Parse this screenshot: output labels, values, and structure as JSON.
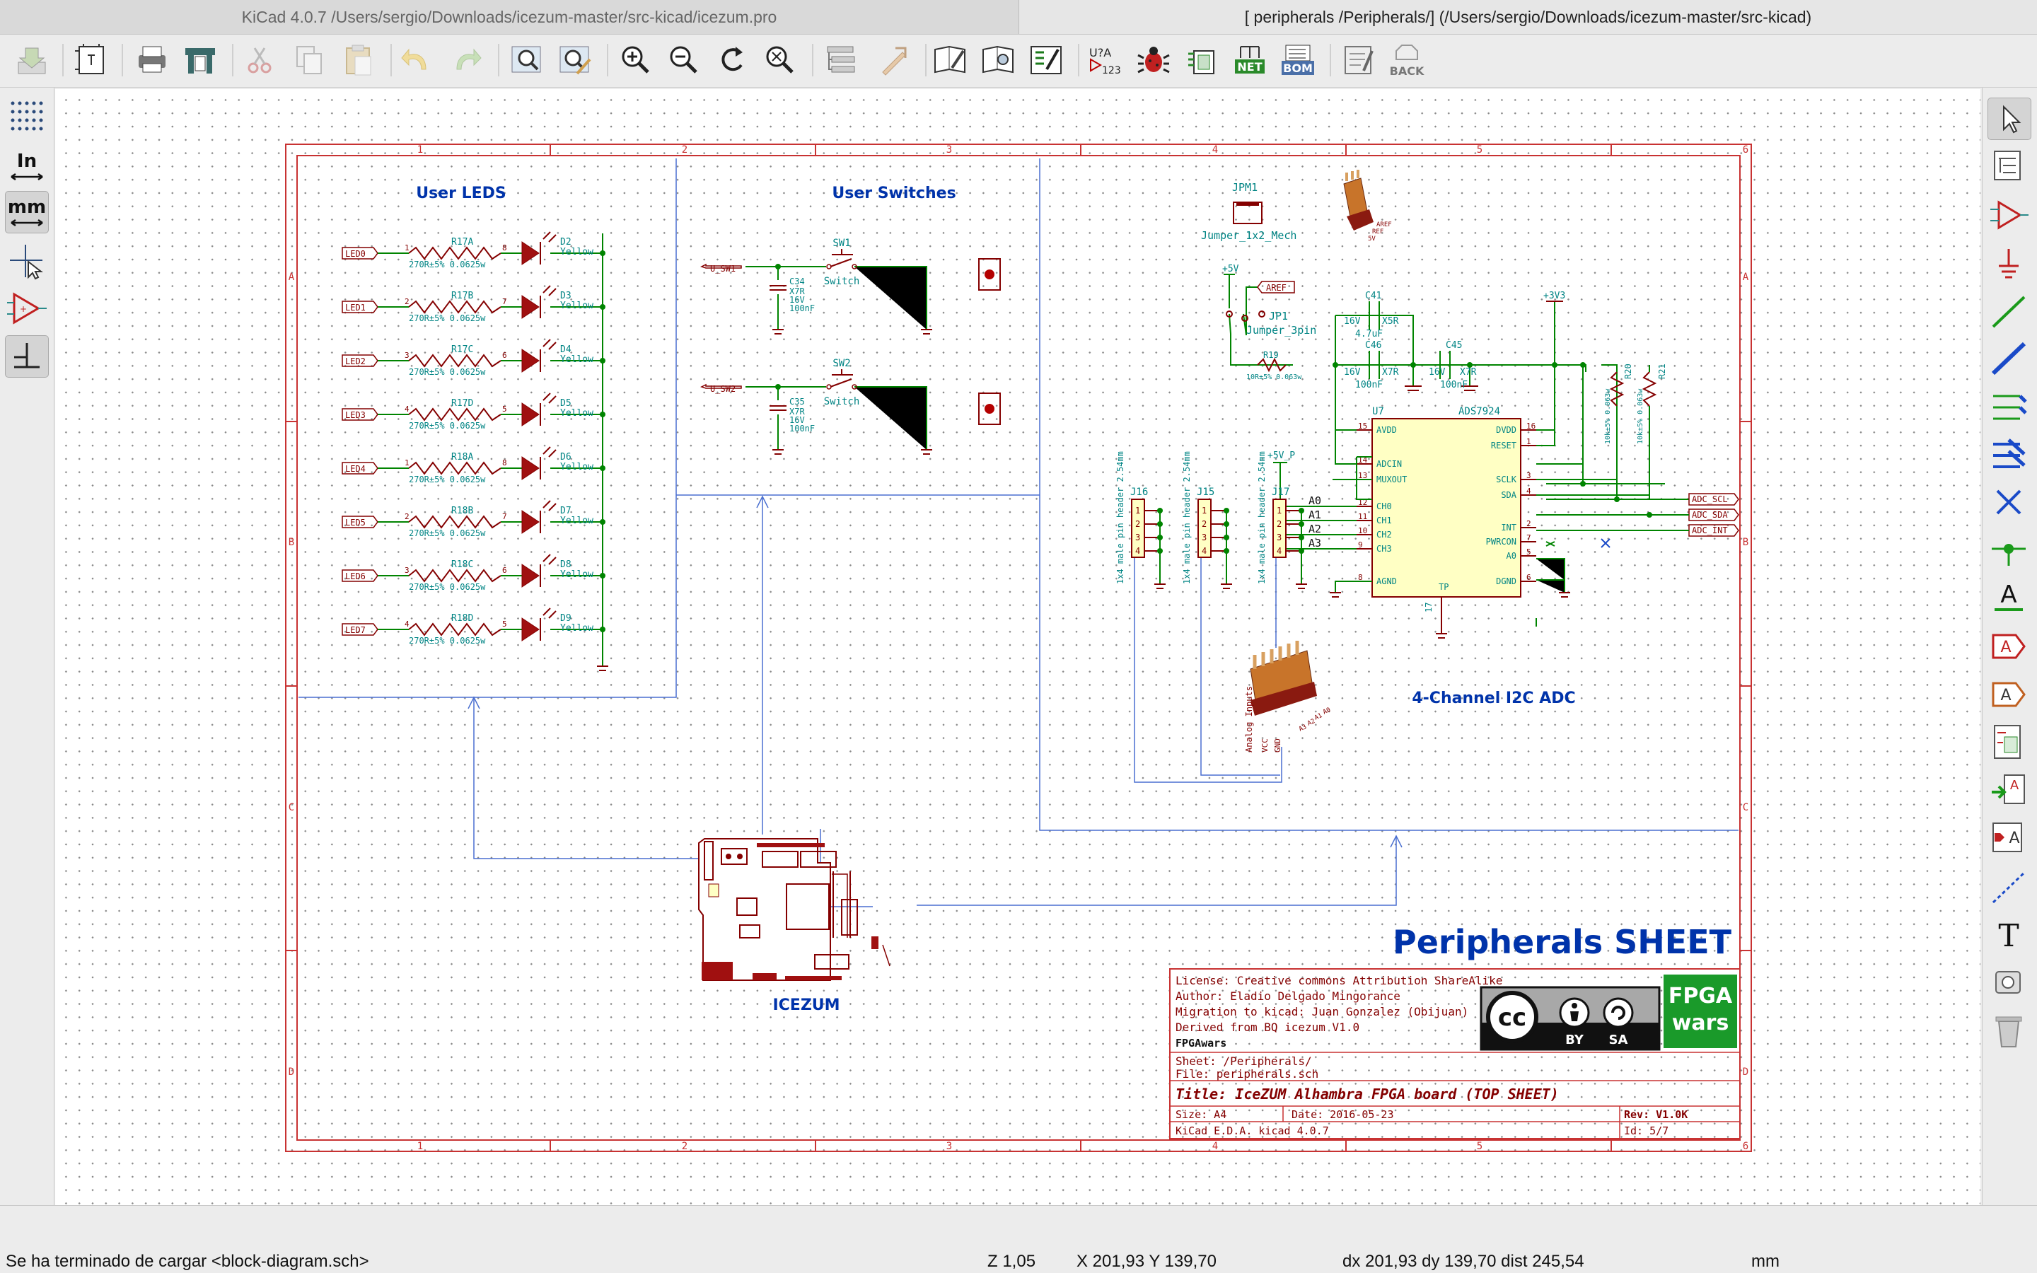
{
  "window": {
    "left_title": "KiCad 4.0.7 /Users/sergio/Downloads/icezum-master/src-kicad/icezum.pro",
    "right_title": "[ peripherals /Peripherals/] (/Users/sergio/Downloads/icezum-master/src-kicad)"
  },
  "toolbar": {
    "items": [
      "save-icon",
      "page-settings-icon",
      "print-icon",
      "plot-icon",
      "cut-icon",
      "copy-icon",
      "paste-icon",
      "undo-icon",
      "redo-icon",
      "find-icon",
      "find-replace-icon",
      "zoom-in-icon",
      "zoom-out-icon",
      "redraw-icon",
      "zoom-fit-icon",
      "hierarchy-navigator-icon",
      "leave-sheet-icon",
      "library-editor-icon",
      "library-browser-icon",
      "annotate-icon",
      "erc-icon",
      "cvpcb-icon",
      "netlist-icon",
      "bom-icon",
      "pcbnew-icon",
      "back-annotate-icon"
    ],
    "annotate_text": "U?A 123",
    "netlist_text": "NET",
    "bom_text": "BOM",
    "back_text": "BACK"
  },
  "left_toolbar": {
    "units_in": "In",
    "units_mm": "mm"
  },
  "right_toolbar": {
    "items": [
      "select-icon",
      "hierarchy-icon",
      "place-component-icon",
      "place-power-icon",
      "wire-icon",
      "bus-icon",
      "wire-bus-entry-icon",
      "bus-bus-entry-icon",
      "no-connect-icon",
      "junction-icon",
      "net-label-icon",
      "global-label-icon",
      "hierarchical-label-icon",
      "hierarchical-sheet-icon",
      "import-sheet-pin-icon",
      "sheet-pin-icon",
      "graphic-line-icon",
      "text-icon",
      "image-icon",
      "delete-icon"
    ],
    "text_letter": "A",
    "text_tool": "T"
  },
  "sheet": {
    "col_marks": [
      "1",
      "2",
      "3",
      "4",
      "5",
      "6"
    ],
    "row_marks": [
      "A",
      "B",
      "C",
      "D"
    ],
    "user_leds_title": "User LEDS",
    "user_switches_title": "User Switches",
    "adc_title": "4-Channel I2C ADC",
    "icezum_label": "ICEZUM",
    "sheet_title": "Peripherals SHEET",
    "leds": [
      {
        "net": "LED0",
        "ref": "R17A",
        "led": "D2",
        "p1": "1",
        "p2": "8"
      },
      {
        "net": "LED1",
        "ref": "R17B",
        "led": "D3",
        "p1": "2",
        "p2": "7"
      },
      {
        "net": "LED2",
        "ref": "R17C",
        "led": "D4",
        "p1": "3",
        "p2": "6"
      },
      {
        "net": "LED3",
        "ref": "R17D",
        "led": "D5",
        "p1": "4",
        "p2": "5"
      },
      {
        "net": "LED4",
        "ref": "R18A",
        "led": "D6",
        "p1": "1",
        "p2": "8"
      },
      {
        "net": "LED5",
        "ref": "R18B",
        "led": "D7",
        "p1": "2",
        "p2": "7"
      },
      {
        "net": "LED6",
        "ref": "R18C",
        "led": "D8",
        "p1": "3",
        "p2": "6"
      },
      {
        "net": "LED7",
        "ref": "R18D",
        "led": "D9",
        "p1": "4",
        "p2": "5"
      }
    ],
    "resistor_value": "270R±5% 0.0625w",
    "led_color": "Yellow",
    "switches": [
      {
        "net": "U_SW1",
        "cap": "C34",
        "sw": "SW1"
      },
      {
        "net": "U_SW2",
        "cap": "C35",
        "sw": "SW2"
      }
    ],
    "switch_label": "Switch",
    "cap_x7r": "X7R",
    "cap_16v": "16V",
    "cap_100nf": "100nF",
    "jpm1_ref": "JPM1",
    "jpm1_val": "Jumper_1x2_Mech",
    "aref_big": "AREF",
    "ref_big": "REF",
    "v5_big": "5V",
    "plus5v": "+5V",
    "aref": "AREF",
    "jp1_ref": "JP1",
    "jp1_val": "Jumper_3pin",
    "r19_ref": "R19",
    "r19_val": "10R±5% 0.063w",
    "c41_ref": "C41",
    "c41_v": "16V",
    "c41_d": "X5R",
    "c41_val": "4.7uF",
    "c46_ref": "C46",
    "c45_ref": "C45",
    "v3v3": "+3V3",
    "r20_ref": "R20",
    "r21_ref": "R21",
    "r20_val": "10k±5% 0.063w",
    "u7_ref": "U7",
    "u7_part": "ADS7924",
    "u7_left": [
      "AVDD",
      "ADCIN",
      "MUXOUT",
      "CH0",
      "CH1",
      "CH2",
      "CH3",
      "AGND"
    ],
    "u7_left_pins": [
      "15",
      "14",
      "13",
      "12",
      "11",
      "10",
      "9",
      "8"
    ],
    "u7_right": [
      "DVDD",
      "RESET",
      "SCLK",
      "SDA",
      "INT",
      "PWRCON",
      "A0",
      "DGND"
    ],
    "u7_right_pins": [
      "16",
      "1",
      "3",
      "4",
      "2",
      "7",
      "5",
      "6"
    ],
    "u7_tp": "TP",
    "u7_tp_pin": "17",
    "adc_scl": "ADC_SCL",
    "adc_sda": "ADC_SDA",
    "adc_int": "ADC_INT",
    "a_labels": [
      "A0",
      "A1",
      "A2",
      "A3"
    ],
    "plus5v_p": "+5V_P",
    "j16": "J16",
    "j15": "J15",
    "j17": "J17",
    "header_label": "1x4 male pin header 2.54mm",
    "pin_nums": [
      "1",
      "2",
      "3",
      "4"
    ],
    "analog_inputs": "Analog Inputs",
    "vcc": "VCC",
    "gnd": "GND",
    "a_small": [
      "A0",
      "A1",
      "A2",
      "A3"
    ]
  },
  "title_block": {
    "license": "License: Creative commons Attribution ShareAlike",
    "author": "Author:  Eladio Delgado Mingorance",
    "migration": "Migration to kicad:  Juan Gonzalez (Obijuan)",
    "derived": "Derived from BQ icezum V1.0",
    "org": "FPGAwars",
    "sheet": "Sheet: /Peripherals/",
    "file": "File: peripherals.sch",
    "title": "Title: IceZUM Alhambra FPGA board (TOP SHEET)",
    "size": "Size: A4",
    "date": "Date: 2016-05-23",
    "rev": "Rev: V1.0K",
    "kicad": "KiCad E.D.A.  kicad 4.0.7",
    "id": "Id: 5/7",
    "cc": "cc",
    "by": "BY",
    "sa": "SA",
    "fpga": "FPGA",
    "wars": "wars"
  },
  "status": {
    "message": "Se ha terminado de cargar <block-diagram.sch>",
    "zoom": "Z 1,05",
    "xy": "X 201,93  Y 139,70",
    "delta": "dx 201,93  dy 139,70  dist 245,54",
    "units": "mm"
  },
  "colors": {
    "wire": "#008400",
    "component": "#840000",
    "text": "#008484",
    "bus": "#4a6fd0",
    "blue_text": "#0033aa",
    "frame": "#c83232",
    "green_logo": "#1a9a2a"
  }
}
